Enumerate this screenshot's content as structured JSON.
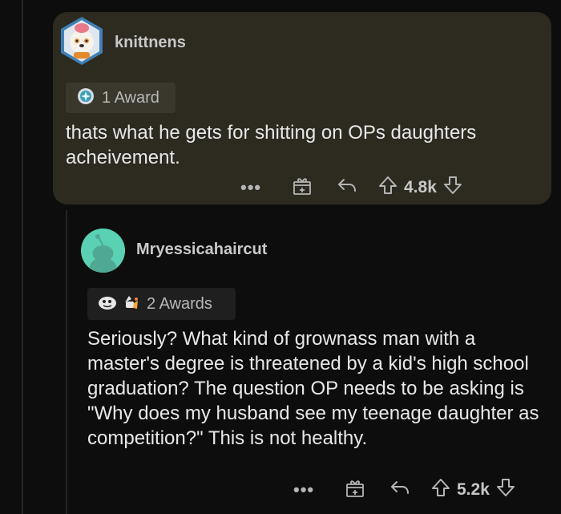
{
  "comments": [
    {
      "username": "knittnens",
      "awards_label": "1 Award",
      "body": "thats what he gets for shitting on OPs daughters acheivement.",
      "score": "4.8k",
      "more": "•••"
    },
    {
      "username": "Mryessicahaircut",
      "awards_label": "2 Awards",
      "body": "Seriously? What kind of grownass man with a master's degree is threatened by a kid's high school graduation? The question OP needs to be asking is \"Why does my husband see my teenage daughter as competition?\" This is not healthy.",
      "score": "5.2k",
      "more": "•••"
    }
  ],
  "colors": {
    "background": "#0d0d0d",
    "highlight": "#2d2a20",
    "avatar_teal": "#5ad1b3"
  },
  "icons": [
    "more-icon",
    "gift-icon",
    "reply-icon",
    "upvote-icon",
    "downvote-icon",
    "award-icon"
  ]
}
